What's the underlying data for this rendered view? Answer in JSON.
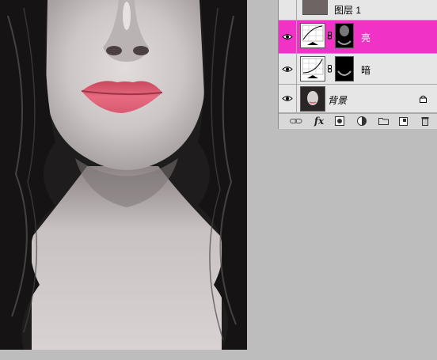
{
  "layers": [
    {
      "name": "图层 1",
      "visible": false,
      "selected": false
    },
    {
      "name": "亮",
      "visible": true,
      "selected": true,
      "type": "curves-adjustment-with-mask"
    },
    {
      "name": "暗",
      "visible": true,
      "selected": false,
      "type": "curves-adjustment-with-mask"
    },
    {
      "name": "背景",
      "visible": true,
      "selected": false,
      "locked": true
    }
  ],
  "toolbar": {
    "fx_label": "fx"
  },
  "colors": {
    "selection": "#f033c6",
    "lips": "#e0566e",
    "canvas_bg": "#bdbdbd"
  }
}
